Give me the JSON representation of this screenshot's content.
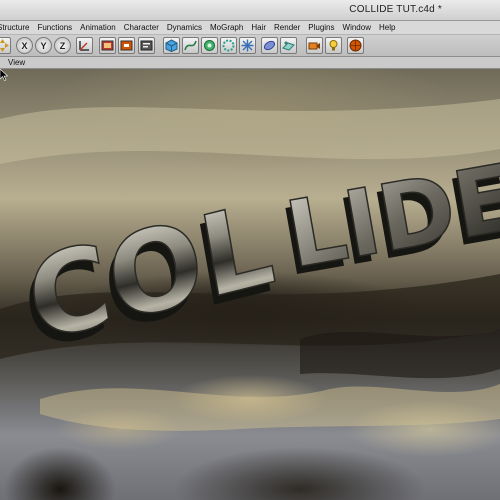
{
  "window": {
    "title": "COLLIDE TUT.c4d *"
  },
  "menu": {
    "items": [
      "Structure",
      "Functions",
      "Animation",
      "Character",
      "Dynamics",
      "MoGraph",
      "Hair",
      "Render",
      "Plugins",
      "Window",
      "Help"
    ]
  },
  "toolbar": {
    "x_label": "X",
    "y_label": "Y",
    "z_label": "Z"
  },
  "viewbar": {
    "label": "View"
  },
  "scene": {
    "word_left": "COL",
    "word_right": "LIDE",
    "text_color": "#9a9a8e"
  },
  "colors": {
    "menubar": "#d9d9d9",
    "toolbar": "#c6c6c6",
    "accent_red": "#c0392b"
  }
}
